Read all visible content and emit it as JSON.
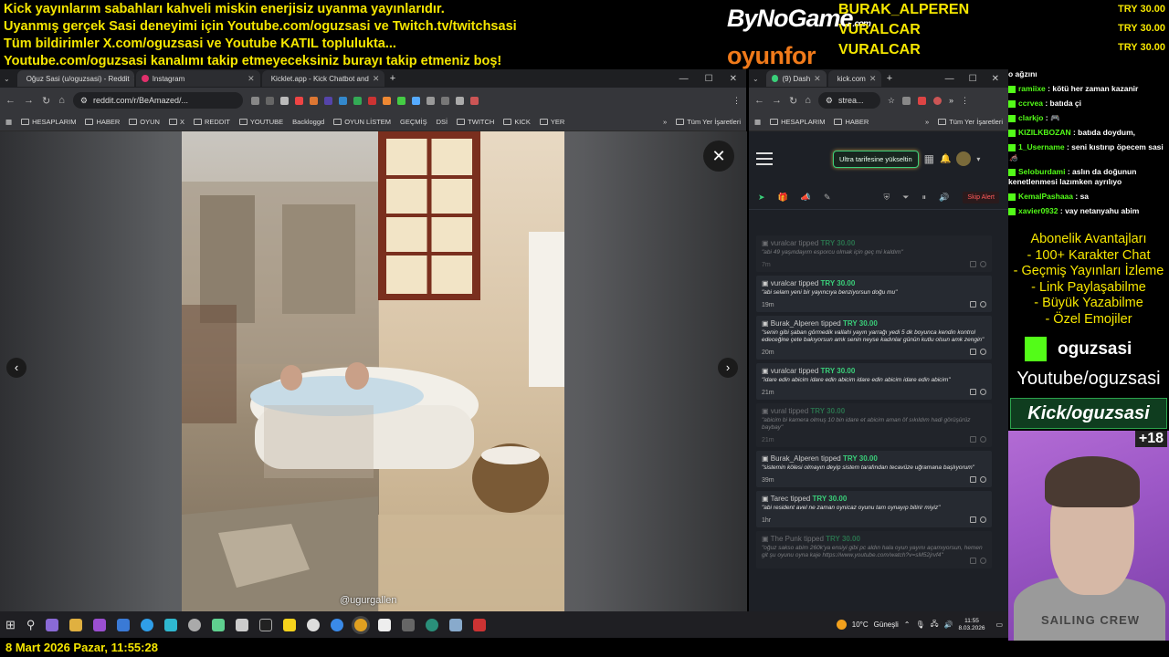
{
  "banner": {
    "lines": [
      "Kick yayınlarım sabahları kahveli miskin enerjisiz uyanma yayınlarıdır.",
      "Uyanmış gerçek Sasi deneyimi için Youtube.com/oguzsasi ve Twitch.tv/twitchsasi",
      "Tüm bildirimler X.com/oguzsasi ve Youtube KATIL toplulukta...",
      "Youtube.com/oguzsasi kanalımı takip etmeyeceksiniz burayı takip etmeniz boş!"
    ]
  },
  "brand": {
    "logo1": "ByNoGame",
    "logo1_suffix": ".com",
    "logo2": "oyunfor"
  },
  "top_donors": {
    "names": [
      "BURAK_ALPEREN",
      "VURALCAR",
      "VURALCAR"
    ],
    "amounts": [
      "TRY 30.00",
      "TRY 30.00",
      "TRY 30.00"
    ]
  },
  "left_browser": {
    "tabs": [
      {
        "title": "Oğuz Sasi (u/oguzsasi) - Reddit",
        "color": "#ff4500"
      },
      {
        "title": "Instagram",
        "color": "#e1306c"
      },
      {
        "title": "Kicklet.app - Kick Chatbot and",
        "color": "#53fc18"
      }
    ],
    "new_tab": "+",
    "url": "reddit.com/r/BeAmazed/...",
    "bookmarks": [
      "HESAPLARIM",
      "HABER",
      "OYUN",
      "X",
      "REDDIT",
      "YOUTUBE",
      "Backloggd",
      "OYUN LİSTEM",
      "GEÇMİŞ",
      "DSİ",
      "TWITCH",
      "KICK",
      "YER"
    ],
    "all_bookmarks": "Tüm Yer İşaretleri",
    "viewer": {
      "watermark": "@ugurgallen",
      "close": "✕",
      "prev": "‹",
      "next": "›"
    }
  },
  "right_browser": {
    "tabs": [
      {
        "title": "(9) Dash",
        "color": "#3ad07a"
      },
      {
        "title": "kick.com",
        "color": "#53fc18"
      }
    ],
    "url": "strea...",
    "bookmarks": [
      "HESAPLARIM",
      "HABER"
    ],
    "all_bookmarks": "Tüm Yer İşaretleri",
    "upgrade_label": "Ultra tarifesine yükseltin",
    "skip_alert": "Skip Alert",
    "feed": [
      {
        "user": "vuralcar",
        "verb": "tipped",
        "amount": "TRY 30.00",
        "message": "\"abi 49 yaşındayım esporcu olmak için geç mi kaldım\"",
        "time": "7m",
        "dim": true
      },
      {
        "user": "vuralcar",
        "verb": "tipped",
        "amount": "TRY 30.00",
        "message": "\"abi selam yeni bir yayıncıya benziyorsun doğu mu\"",
        "time": "19m",
        "dim": false
      },
      {
        "user": "Burak_Alperen",
        "verb": "tipped",
        "amount": "TRY 30.00",
        "message": "\"senin gibi şaban görmedik vallahi yayın yarrağı yedi 5 dk boyunca kendin kontrol edeceğine çete bakıyorsun amk senin neyse kadınlar günün kutlu olsun amk zengin\"",
        "time": "20m",
        "dim": false
      },
      {
        "user": "vuralcar",
        "verb": "tipped",
        "amount": "TRY 30.00",
        "message": "\"idare edin abicim idare edin abicim idare edin abicim idare edin abicim\"",
        "time": "21m",
        "dim": false
      },
      {
        "user": "vural",
        "verb": "tipped",
        "amount": "TRY 30.00",
        "message": "\"abicim bi kamera olmuş 10 bin idare et abicim aman öf sıkıldım hadi görüşürüz baybay\"",
        "time": "21m",
        "dim": true
      },
      {
        "user": "Burak_Alperen",
        "verb": "tipped",
        "amount": "TRY 30.00",
        "message": "\"sistemin kölesi olmayın deyip sistem tarafından tecavüze uğramana başlıyorum\"",
        "time": "39m",
        "dim": false
      },
      {
        "user": "Tarec",
        "verb": "tipped",
        "amount": "TRY 30.00",
        "message": "\"abi resident avel ne zaman oynicaz oyunu tam oynayıp bitirir miyiz\"",
        "time": "1hr",
        "dim": false
      },
      {
        "user": "The Punk",
        "verb": "tipped",
        "amount": "TRY 30.00",
        "message": "\"oğuz sakso abim 260k'ya ensiyi gibi pc aldın hala oyun yayını açamıyorsun, hemen git şu oyunu oyna kaje https://www.youtube.com/watch?v=sM52jrvf4\"",
        "time": "",
        "dim": true
      }
    ]
  },
  "chat": [
    {
      "user": "",
      "text": "o ağzını"
    },
    {
      "user": "ramiixe",
      "text": ": kötü her zaman kazanir"
    },
    {
      "user": "ccrvea",
      "text": ": batıda çi"
    },
    {
      "user": "clarkjo",
      "text": ": 🎮"
    },
    {
      "user": "KIZILKBOZAN",
      "text": ": batıda doydum,"
    },
    {
      "user": "1_Username",
      "text": ": seni kıstırıp öpecem sasi 🦽"
    },
    {
      "user": "Seloburdami",
      "text": ": aslın da doğunun kenetlenmesi lazımken ayrılıyo"
    },
    {
      "user": "KemalPashaaa",
      "text": ": sa"
    },
    {
      "user": "xavier0932",
      "text": ": vay netanyahu abim"
    }
  ],
  "perks": [
    "Abonelik Avantajları",
    "- 100+ Karakter Chat",
    "- Geçmiş Yayınları İzleme",
    "- Link Paylaşabilme",
    "- Büyük Yazabilme",
    "- Özel Emojiler"
  ],
  "kick_name": "oguzsasi",
  "youtube_text": "Youtube/oguzsasi",
  "kick_box": "Kick/oguzsasi",
  "age_badge": "+18",
  "hoodie_text": "SAILING CREW",
  "taskbar": {
    "weather_temp": "10°C",
    "weather_text": "Güneşli",
    "time": "11:55",
    "date": "8.03.2026"
  },
  "date_line": "8 Mart 2026 Pazar, 11:55:28"
}
